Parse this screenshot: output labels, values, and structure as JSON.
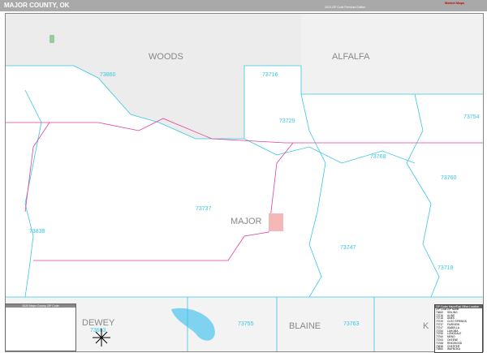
{
  "header": {
    "title": "MAJOR COUNTY, OK",
    "edition": "2020 ZIP Code Premium Edition",
    "logo": "Market Maps"
  },
  "counties": [
    "WOODS",
    "ALFALFA",
    "MAJOR",
    "DEWEY",
    "BLAINE",
    "K"
  ],
  "zips": [
    "73860",
    "73716",
    "73729",
    "73754",
    "73768",
    "73760",
    "73737",
    "73838",
    "73747",
    "73718",
    "73663",
    "73755",
    "73763"
  ],
  "legend": {
    "title": "2020 Major County ZIP Code"
  },
  "zip_table": {
    "title": "ZIP Codes Major/Post Office Location",
    "headers": [
      "ZIP Code",
      "ZIP Name"
    ],
    "rows": [
      [
        "73663",
        "SEILING"
      ],
      [
        "73716",
        "ALINE"
      ],
      [
        "73718",
        "AMES"
      ],
      [
        "73729",
        "CLEO SPRINGS"
      ],
      [
        "73737",
        "FAIRVIEW"
      ],
      [
        "73747",
        "ISABELLA"
      ],
      [
        "73754",
        "LAHOMA"
      ],
      [
        "73755",
        "LONGDALE"
      ],
      [
        "73760",
        "MENO"
      ],
      [
        "73763",
        "OKEENE"
      ],
      [
        "73768",
        "RINGWOOD"
      ],
      [
        "73838",
        "CHESTER"
      ],
      [
        "73860",
        "WAYNOKA"
      ]
    ]
  },
  "colors": {
    "zip_boundary": "#37c6e8",
    "highway": "#e0409a",
    "outside": "#efefef",
    "header": "#a9a9a9"
  }
}
